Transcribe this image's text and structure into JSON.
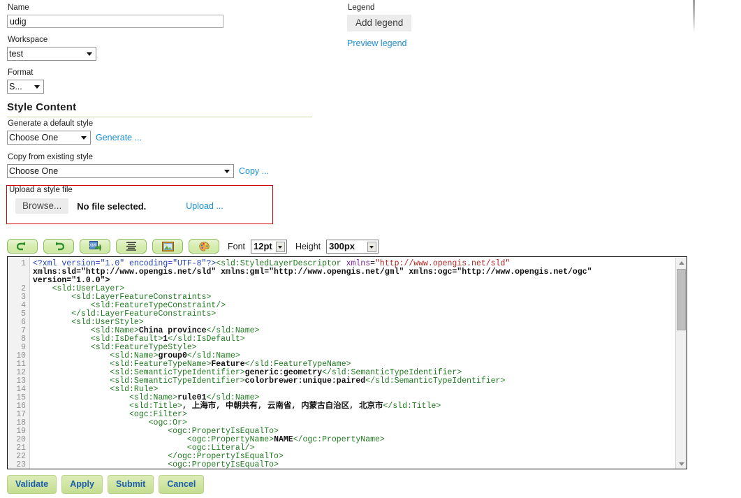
{
  "form": {
    "name_label": "Name",
    "name_value": "udig",
    "workspace_label": "Workspace",
    "workspace_value": "test",
    "format_label": "Format",
    "format_value": "S..."
  },
  "legend": {
    "label": "Legend",
    "add_button": "Add legend",
    "preview_link": "Preview legend"
  },
  "style_content": {
    "heading": "Style Content",
    "generate_label": "Generate a default style",
    "generate_select_value": "Choose One",
    "generate_link": "Generate ...",
    "copy_label": "Copy from existing style",
    "copy_select_value": "Choose One",
    "copy_link": "Copy ...",
    "upload_label": "Upload a style file",
    "browse_button": "Browse...",
    "no_file_text": "No file selected.",
    "upload_link": "Upload ..."
  },
  "toolbar": {
    "icons": [
      {
        "name": "undo-icon",
        "title": "Undo"
      },
      {
        "name": "redo-icon",
        "title": "Redo"
      },
      {
        "name": "insert-xml-icon",
        "title": "Insert XML"
      },
      {
        "name": "format-indent-icon",
        "title": "Format"
      },
      {
        "name": "insert-image-icon",
        "title": "Insert image"
      },
      {
        "name": "color-palette-icon",
        "title": "Colors"
      }
    ],
    "font_label": "Font",
    "font_value": "12pt",
    "height_label": "Height",
    "height_value": "300px"
  },
  "editor": {
    "line_numbers": [
      1,
      2,
      3,
      4,
      5,
      6,
      7,
      8,
      9,
      10,
      11,
      12,
      13,
      14,
      15,
      16,
      17,
      18,
      19,
      20,
      21,
      22,
      23
    ],
    "lines": [
      "<?xml version=\"1.0\" encoding=\"UTF-8\"?><sld:StyledLayerDescriptor xmlns=\"http://www.opengis.net/sld\"",
      "xmlns:sld=\"http://www.opengis.net/sld\" xmlns:gml=\"http://www.opengis.net/gml\" xmlns:ogc=\"http://www.opengis.net/ogc\"",
      "version=\"1.0.0\">",
      "    <sld:UserLayer>",
      "        <sld:LayerFeatureConstraints>",
      "            <sld:FeatureTypeConstraint/>",
      "        </sld:LayerFeatureConstraints>",
      "        <sld:UserStyle>",
      "            <sld:Name>China province</sld:Name>",
      "            <sld:IsDefault>1</sld:IsDefault>",
      "            <sld:FeatureTypeStyle>",
      "                <sld:Name>group0</sld:Name>",
      "                <sld:FeatureTypeName>Feature</sld:FeatureTypeName>",
      "                <sld:SemanticTypeIdentifier>generic:geometry</sld:SemanticTypeIdentifier>",
      "                <sld:SemanticTypeIdentifier>colorbrewer:unique:paired</sld:SemanticTypeIdentifier>",
      "                <sld:Rule>",
      "                    <sld:Name>rule01</sld:Name>",
      "                    <sld:Title>, 上海市, 中朝共有, 云南省, 内蒙古自治区, 北京市</sld:Title>",
      "                    <ogc:Filter>",
      "                        <ogc:Or>",
      "                            <ogc:PropertyIsEqualTo>",
      "                                <ogc:PropertyName>NAME</ogc:PropertyName>",
      "                                <ogc:Literal/>",
      "                            </ogc:PropertyIsEqualTo>",
      "                            <ogc:PropertyIsEqualTo>"
    ]
  },
  "buttons": {
    "validate": "Validate",
    "apply": "Apply",
    "submit": "Submit",
    "cancel": "Cancel"
  },
  "colors": {
    "link": "#1a8fd6",
    "error_border": "#d00000",
    "button_green": "#cfe5a2",
    "button_text": "#1b5faa",
    "heading_rule": "#c9d9a0"
  }
}
